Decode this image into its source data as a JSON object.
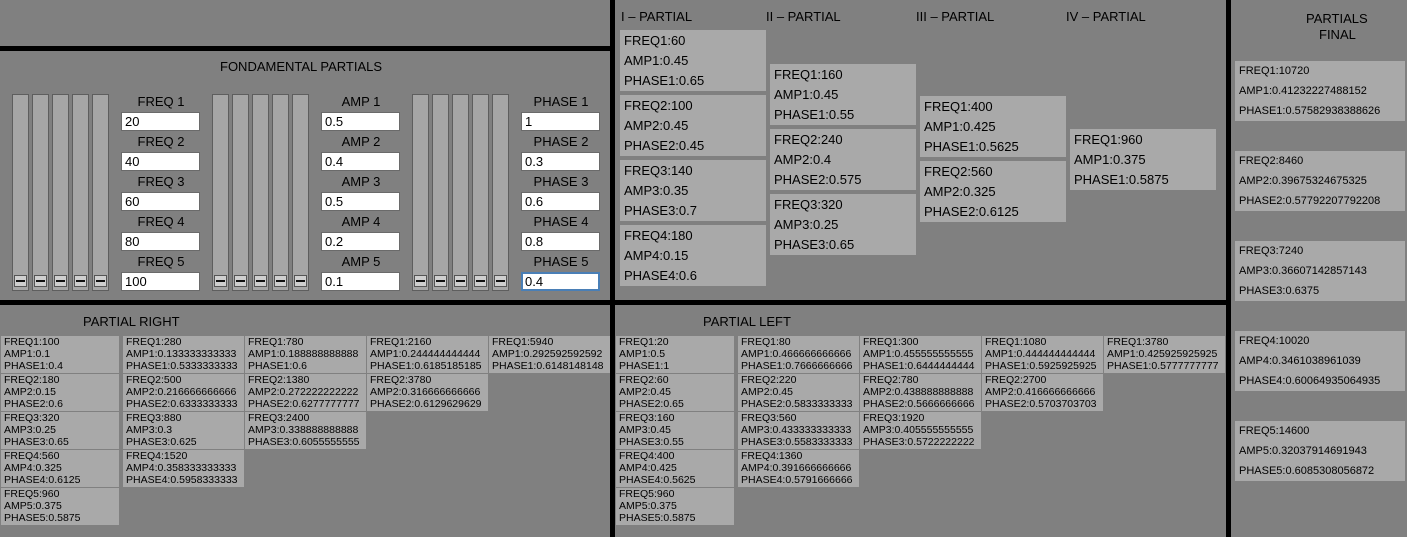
{
  "fundamental": {
    "title": "FONDAMENTAL PARTIALS",
    "freq": {
      "labels": [
        "FREQ 1",
        "FREQ 2",
        "FREQ 3",
        "FREQ 4",
        "FREQ 5"
      ],
      "values": [
        "20",
        "40",
        "60",
        "80",
        "100"
      ],
      "slider_levels": [
        0,
        0,
        0,
        0,
        0
      ]
    },
    "amp": {
      "labels": [
        "AMP 1",
        "AMP 2",
        "AMP 3",
        "AMP 4",
        "AMP 5"
      ],
      "values": [
        "0.5",
        "0.4",
        "0.5",
        "0.2",
        "0.1"
      ],
      "slider_levels": [
        0,
        0,
        0,
        0,
        0
      ]
    },
    "phase": {
      "labels": [
        "PHASE 1",
        "PHASE 2",
        "PHASE 3",
        "PHASE 4",
        "PHASE 5"
      ],
      "values": [
        "1",
        "0.3",
        "0.6",
        "0.8",
        "0.4"
      ],
      "slider_levels": [
        0,
        0,
        0,
        0,
        0
      ]
    }
  },
  "partials": {
    "headers": [
      "I – PARTIAL",
      "II – PARTIAL",
      "III – PARTIAL",
      "IV – PARTIAL"
    ],
    "columns": [
      [
        [
          "FREQ1:60",
          "AMP1:0.45",
          "PHASE1:0.65"
        ],
        [
          "FREQ2:100",
          "AMP2:0.45",
          "PHASE2:0.45"
        ],
        [
          "FREQ3:140",
          "AMP3:0.35",
          "PHASE3:0.7"
        ],
        [
          "FREQ4:180",
          "AMP4:0.15",
          "PHASE4:0.6"
        ]
      ],
      [
        [
          "FREQ1:160",
          "AMP1:0.45",
          "PHASE1:0.55"
        ],
        [
          "FREQ2:240",
          "AMP2:0.4",
          "PHASE2:0.575"
        ],
        [
          "FREQ3:320",
          "AMP3:0.25",
          "PHASE3:0.65"
        ]
      ],
      [
        [
          "FREQ1:400",
          "AMP1:0.425",
          "PHASE1:0.5625"
        ],
        [
          "FREQ2:560",
          "AMP2:0.325",
          "PHASE2:0.6125"
        ]
      ],
      [
        [
          "FREQ1:960",
          "AMP1:0.375",
          "PHASE1:0.5875"
        ]
      ]
    ]
  },
  "partial_right": {
    "title": "PARTIAL RIGHT",
    "columns": [
      [
        [
          "FREQ1:100",
          "AMP1:0.1",
          "PHASE1:0.4"
        ],
        [
          "FREQ2:180",
          "AMP2:0.15",
          "PHASE2:0.6"
        ],
        [
          "FREQ3:320",
          "AMP3:0.25",
          "PHASE3:0.65"
        ],
        [
          "FREQ4:560",
          "AMP4:0.325",
          "PHASE4:0.6125"
        ],
        [
          "FREQ5:960",
          "AMP5:0.375",
          "PHASE5:0.5875"
        ]
      ],
      [
        [
          "FREQ1:280",
          "AMP1:0.133333333333",
          "PHASE1:0.5333333333"
        ],
        [
          "FREQ2:500",
          "AMP2:0.216666666666",
          "PHASE2:0.6333333333"
        ],
        [
          "FREQ3:880",
          "AMP3:0.3",
          "PHASE3:0.625"
        ],
        [
          "FREQ4:1520",
          "AMP4:0.358333333333",
          "PHASE4:0.5958333333"
        ]
      ],
      [
        [
          "FREQ1:780",
          "AMP1:0.188888888888",
          "PHASE1:0.6"
        ],
        [
          "FREQ2:1380",
          "AMP2:0.272222222222",
          "PHASE2:0.6277777777"
        ],
        [
          "FREQ3:2400",
          "AMP3:0.338888888888",
          "PHASE3:0.6055555555"
        ]
      ],
      [
        [
          "FREQ1:2160",
          "AMP1:0.244444444444",
          "PHASE1:0.6185185185"
        ],
        [
          "FREQ2:3780",
          "AMP2:0.316666666666",
          "PHASE2:0.6129629629"
        ]
      ],
      [
        [
          "FREQ1:5940",
          "AMP1:0.292592592592",
          "PHASE1:0.6148148148"
        ]
      ]
    ]
  },
  "partial_left": {
    "title": "PARTIAL LEFT",
    "columns": [
      [
        [
          "FREQ1:20",
          "AMP1:0.5",
          "PHASE1:1"
        ],
        [
          "FREQ2:60",
          "AMP2:0.45",
          "PHASE2:0.65"
        ],
        [
          "FREQ3:160",
          "AMP3:0.45",
          "PHASE3:0.55"
        ],
        [
          "FREQ4:400",
          "AMP4:0.425",
          "PHASE4:0.5625"
        ],
        [
          "FREQ5:960",
          "AMP5:0.375",
          "PHASE5:0.5875"
        ]
      ],
      [
        [
          "FREQ1:80",
          "AMP1:0.466666666666",
          "PHASE1:0.7666666666"
        ],
        [
          "FREQ2:220",
          "AMP2:0.45",
          "PHASE2:0.5833333333"
        ],
        [
          "FREQ3:560",
          "AMP3:0.433333333333",
          "PHASE3:0.5583333333"
        ],
        [
          "FREQ4:1360",
          "AMP4:0.391666666666",
          "PHASE4:0.5791666666"
        ]
      ],
      [
        [
          "FREQ1:300",
          "AMP1:0.455555555555",
          "PHASE1:0.6444444444"
        ],
        [
          "FREQ2:780",
          "AMP2:0.438888888888",
          "PHASE2:0.5666666666"
        ],
        [
          "FREQ3:1920",
          "AMP3:0.405555555555",
          "PHASE3:0.5722222222"
        ]
      ],
      [
        [
          "FREQ1:1080",
          "AMP1:0.444444444444",
          "PHASE1:0.5925925925"
        ],
        [
          "FREQ2:2700",
          "AMP2:0.416666666666",
          "PHASE2:0.5703703703"
        ]
      ],
      [
        [
          "FREQ1:3780",
          "AMP1:0.425925925925",
          "PHASE1:0.5777777777"
        ]
      ]
    ]
  },
  "final": {
    "title_line1": "PARTIALS",
    "title_line2": "FINAL",
    "boxes": [
      [
        "FREQ1:10720",
        "AMP1:0.41232227488152",
        "PHASE1:0.57582938388626"
      ],
      [
        "FREQ2:8460",
        "AMP2:0.39675324675325",
        "PHASE2:0.57792207792208"
      ],
      [
        "FREQ3:7240",
        "AMP3:0.36607142857143",
        "PHASE3:0.6375"
      ],
      [
        "FREQ4:10020",
        "AMP4:0.3461038961039",
        "PHASE4:0.60064935064935"
      ],
      [
        "FREQ5:14600",
        "AMP5:0.32037914691943",
        "PHASE5:0.6085308056872"
      ]
    ]
  }
}
